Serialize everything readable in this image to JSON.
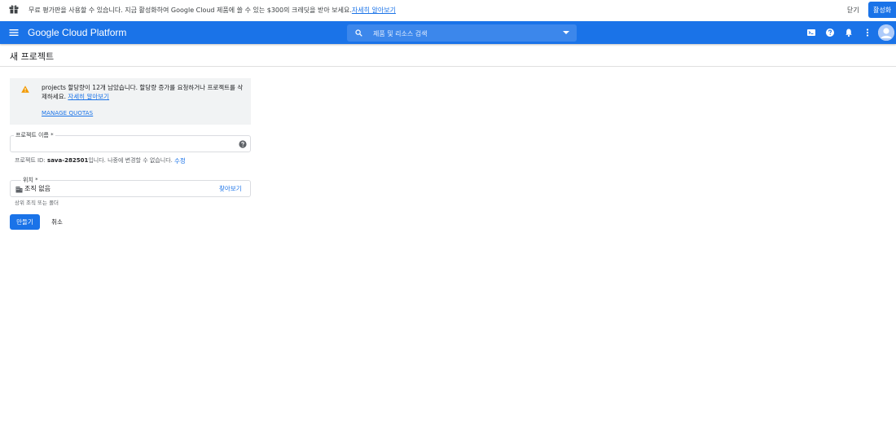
{
  "promo": {
    "message": "무료 평가판을 사용할 수 있습니다. 지금 활성화하여 Google Cloud 제품에 쓸 수 있는 $300의 크레딧을 받아 보세요.",
    "learn_more": "자세히 알아보기",
    "dismiss": "닫기",
    "activate": "활성화"
  },
  "appbar": {
    "brand": "Google Cloud Platform",
    "search_placeholder": "제품 및 리소스 검색",
    "icons": [
      "terminal-icon",
      "help-icon",
      "notifications-icon",
      "more-vert-icon"
    ],
    "accent": "#1a73e8"
  },
  "page": {
    "title": "새 프로젝트"
  },
  "quota_warning": {
    "message_before": "projects 할당량이 12개 남았습니다. 할당량 증가를 요청하거나 프로젝트를 삭제하세요.",
    "learn_more": "자세히 알아보기",
    "manage": "MANAGE QUOTAS"
  },
  "project_name": {
    "label": "프로젝트 이름 *",
    "value": ""
  },
  "project_id": {
    "prefix": "프로젝트 ID: ",
    "id": "sava-282501",
    "suffix": "입니다. 나중에 변경할 수 없습니다.",
    "edit": "수정"
  },
  "location": {
    "label": "위치 *",
    "value": "조직 없음",
    "browse": "찾아보기",
    "helper": "상위 조직 또는 폴더"
  },
  "actions": {
    "create": "만들기",
    "cancel": "취소"
  }
}
